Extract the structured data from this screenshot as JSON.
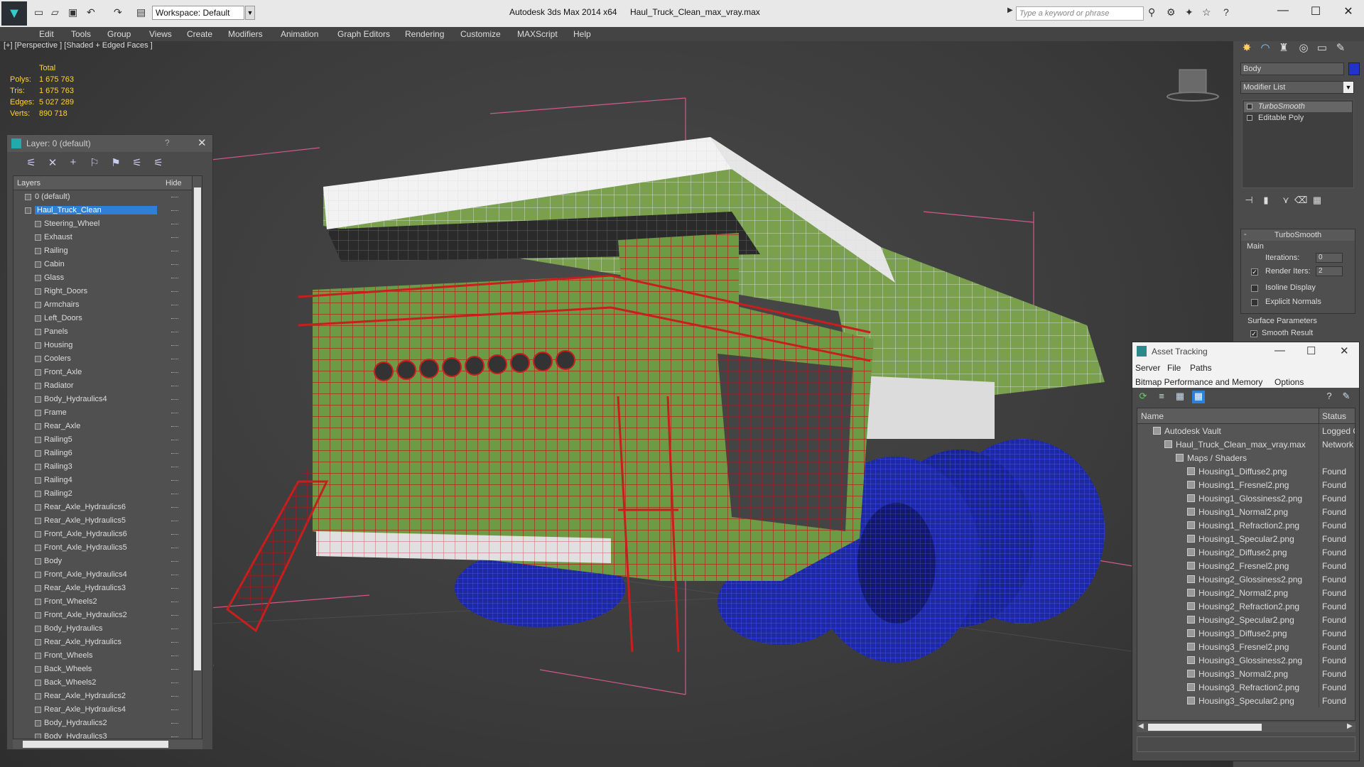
{
  "titlebar": {
    "workspace": "Workspace: Default",
    "app_title": "Autodesk 3ds Max  2014 x64",
    "file_title": "Haul_Truck_Clean_max_vray.max",
    "search_placeholder": "Type a keyword or phrase"
  },
  "menu": [
    "Edit",
    "Tools",
    "Group",
    "Views",
    "Create",
    "Modifiers",
    "Animation",
    "Graph Editors",
    "Rendering",
    "Customize",
    "MAXScript",
    "Help"
  ],
  "viewport": {
    "label": "[+] [Perspective ] [Shaded + Edged Faces ]",
    "stats_header": "Total",
    "stats": [
      {
        "label": "Polys:",
        "value": "1 675 763"
      },
      {
        "label": "Tris:",
        "value": "1 675 763"
      },
      {
        "label": "Edges:",
        "value": "5 027 289"
      },
      {
        "label": "Verts:",
        "value": "890 718"
      }
    ]
  },
  "layers": {
    "title": "Layer: 0 (default)",
    "help": "?",
    "col_layers": "Layers",
    "col_hide": "Hide",
    "items": [
      {
        "name": "0 (default)",
        "level": 1
      },
      {
        "name": "Haul_Truck_Clean",
        "level": 1,
        "selected": true
      },
      {
        "name": "Steering_Wheel",
        "level": 2
      },
      {
        "name": "Exhaust",
        "level": 2
      },
      {
        "name": "Railing",
        "level": 2
      },
      {
        "name": "Cabin",
        "level": 2
      },
      {
        "name": "Glass",
        "level": 2
      },
      {
        "name": "Right_Doors",
        "level": 2
      },
      {
        "name": "Armchairs",
        "level": 2
      },
      {
        "name": "Left_Doors",
        "level": 2
      },
      {
        "name": "Panels",
        "level": 2
      },
      {
        "name": "Housing",
        "level": 2
      },
      {
        "name": "Coolers",
        "level": 2
      },
      {
        "name": "Front_Axle",
        "level": 2
      },
      {
        "name": "Radiator",
        "level": 2
      },
      {
        "name": "Body_Hydraulics4",
        "level": 2
      },
      {
        "name": "Frame",
        "level": 2
      },
      {
        "name": "Rear_Axle",
        "level": 2
      },
      {
        "name": "Railing5",
        "level": 2
      },
      {
        "name": "Railing6",
        "level": 2
      },
      {
        "name": "Railing3",
        "level": 2
      },
      {
        "name": "Railing4",
        "level": 2
      },
      {
        "name": "Railing2",
        "level": 2
      },
      {
        "name": "Rear_Axle_Hydraulics6",
        "level": 2
      },
      {
        "name": "Rear_Axle_Hydraulics5",
        "level": 2
      },
      {
        "name": "Front_Axle_Hydraulics6",
        "level": 2
      },
      {
        "name": "Front_Axle_Hydraulics5",
        "level": 2
      },
      {
        "name": "Body",
        "level": 2
      },
      {
        "name": "Front_Axle_Hydraulics4",
        "level": 2
      },
      {
        "name": "Rear_Axle_Hydraulics3",
        "level": 2
      },
      {
        "name": "Front_Wheels2",
        "level": 2
      },
      {
        "name": "Front_Axle_Hydraulics2",
        "level": 2
      },
      {
        "name": "Body_Hydraulics",
        "level": 2
      },
      {
        "name": "Rear_Axle_Hydraulics",
        "level": 2
      },
      {
        "name": "Front_Wheels",
        "level": 2
      },
      {
        "name": "Back_Wheels",
        "level": 2
      },
      {
        "name": "Back_Wheels2",
        "level": 2
      },
      {
        "name": "Rear_Axle_Hydraulics2",
        "level": 2
      },
      {
        "name": "Rear_Axle_Hydraulics4",
        "level": 2
      },
      {
        "name": "Body_Hydraulics2",
        "level": 2
      },
      {
        "name": "Body_Hydraulics3",
        "level": 2
      }
    ]
  },
  "command": {
    "object_name": "Body",
    "object_color": "#2233cc",
    "modifier_list": "Modifier List",
    "stack": [
      "TurboSmooth",
      "Editable Poly"
    ],
    "rollout_title": "TurboSmooth",
    "rollout_toggle": "-",
    "main": "Main",
    "iterations_label": "Iterations:",
    "iterations_value": "0",
    "render_iters_label": "Render Iters:",
    "render_iters_value": "2",
    "isoline": "Isoline Display",
    "explicit": "Explicit Normals",
    "surface": "Surface Parameters",
    "smooth_result": "Smooth Result"
  },
  "asset": {
    "title": "Asset Tracking",
    "menu1": [
      "Server",
      "File",
      "Paths"
    ],
    "menu2": [
      "Bitmap Performance and Memory",
      "Options"
    ],
    "col_name": "Name",
    "col_status": "Status",
    "rows": [
      {
        "name": "Autodesk Vault",
        "status": "Logged C",
        "level": 1
      },
      {
        "name": "Haul_Truck_Clean_max_vray.max",
        "status": "Network",
        "level": 2
      },
      {
        "name": "Maps / Shaders",
        "status": "",
        "level": 3
      },
      {
        "name": "Housing1_Diffuse2.png",
        "status": "Found",
        "level": 4
      },
      {
        "name": "Housing1_Fresnel2.png",
        "status": "Found",
        "level": 4
      },
      {
        "name": "Housing1_Glossiness2.png",
        "status": "Found",
        "level": 4
      },
      {
        "name": "Housing1_Normal2.png",
        "status": "Found",
        "level": 4
      },
      {
        "name": "Housing1_Refraction2.png",
        "status": "Found",
        "level": 4
      },
      {
        "name": "Housing1_Specular2.png",
        "status": "Found",
        "level": 4
      },
      {
        "name": "Housing2_Diffuse2.png",
        "status": "Found",
        "level": 4
      },
      {
        "name": "Housing2_Fresnel2.png",
        "status": "Found",
        "level": 4
      },
      {
        "name": "Housing2_Glossiness2.png",
        "status": "Found",
        "level": 4
      },
      {
        "name": "Housing2_Normal2.png",
        "status": "Found",
        "level": 4
      },
      {
        "name": "Housing2_Refraction2.png",
        "status": "Found",
        "level": 4
      },
      {
        "name": "Housing2_Specular2.png",
        "status": "Found",
        "level": 4
      },
      {
        "name": "Housing3_Diffuse2.png",
        "status": "Found",
        "level": 4
      },
      {
        "name": "Housing3_Fresnel2.png",
        "status": "Found",
        "level": 4
      },
      {
        "name": "Housing3_Glossiness2.png",
        "status": "Found",
        "level": 4
      },
      {
        "name": "Housing3_Normal2.png",
        "status": "Found",
        "level": 4
      },
      {
        "name": "Housing3_Refraction2.png",
        "status": "Found",
        "level": 4
      },
      {
        "name": "Housing3_Specular2.png",
        "status": "Found",
        "level": 4
      }
    ]
  },
  "colors": {
    "selection_wire": "#c81e1e",
    "body_green": "#6e9a46",
    "wheel_blue": "#1e28a0",
    "stats_yellow": "#ffd23c"
  }
}
